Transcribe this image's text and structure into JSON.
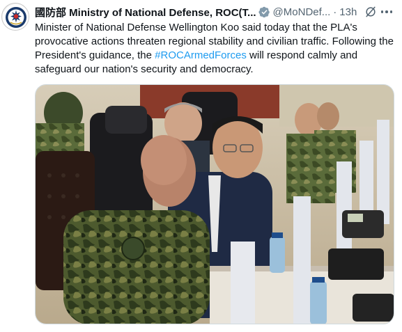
{
  "tweet": {
    "author_name": "國防部 Ministry of National Defense, ROC(T...",
    "handle": "@MoNDef...",
    "separator": "·",
    "time": "13h",
    "text_before": "Minister of National Defense Wellington Koo said today that the PLA's provocative actions threaten regional stability and civilian traffic. Following the President's guidance, the ",
    "hashtag": "#ROCArmedForces",
    "text_after": " will respond calmly and safeguard our nation's security and democracy."
  },
  "icons": {
    "avatar": "ministry-emblem-icon",
    "verified": "verified-badge-icon",
    "grok": "grok-icon",
    "more": "more-icon"
  },
  "colors": {
    "accent": "#1d9bf0",
    "text": "#0f1419",
    "secondary": "#536471",
    "verified_badge": "#829aab"
  }
}
